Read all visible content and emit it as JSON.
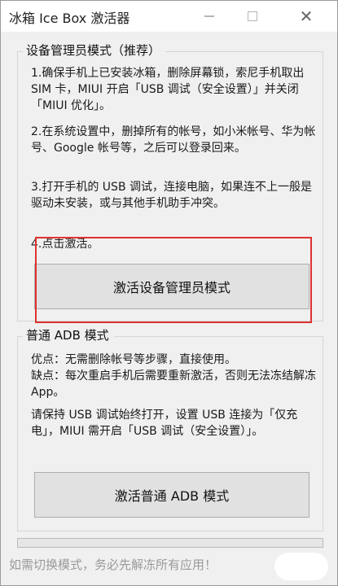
{
  "window": {
    "title": "冰箱 Ice Box 激活器"
  },
  "device_owner": {
    "legend": "设备管理员模式（推荐）",
    "step1": "1.确保手机上已安装冰箱，删除屏幕锁，索尼手机取出 SIM 卡，MIUI 开启「USB 调试（安全设置）」并关闭「MIUI 优化」。",
    "step2": "2.在系统设置中，删掉所有的帐号，如小米帐号、华为帐号、Google 帐号等，之后可以登录回来。",
    "step3": "3.打开手机的 USB 调试，连接电脑，如果连不上一般是驱动未安装，或与其他手机助手冲突。",
    "step4": "4.点击激活。",
    "button_label": "激活设备管理员模式"
  },
  "adb_mode": {
    "legend": "普通 ADB 模式",
    "pros": "优点：无需删除帐号等步骤，直接使用。",
    "cons": "缺点：每次重启手机后需要重新激活，否则无法冻结解冻 App。",
    "note": "请保持 USB 调试始终打开，设置 USB 连接为「仅充电」，MIUI 需开启「USB 调试（安全设置）」。",
    "button_label": "激活普通 ADB 模式"
  },
  "status_text": "如需切换模式，务必先解冻所有应用！",
  "colors": {
    "highlight": "#e03232",
    "window_bg": "#f0f0f0"
  }
}
